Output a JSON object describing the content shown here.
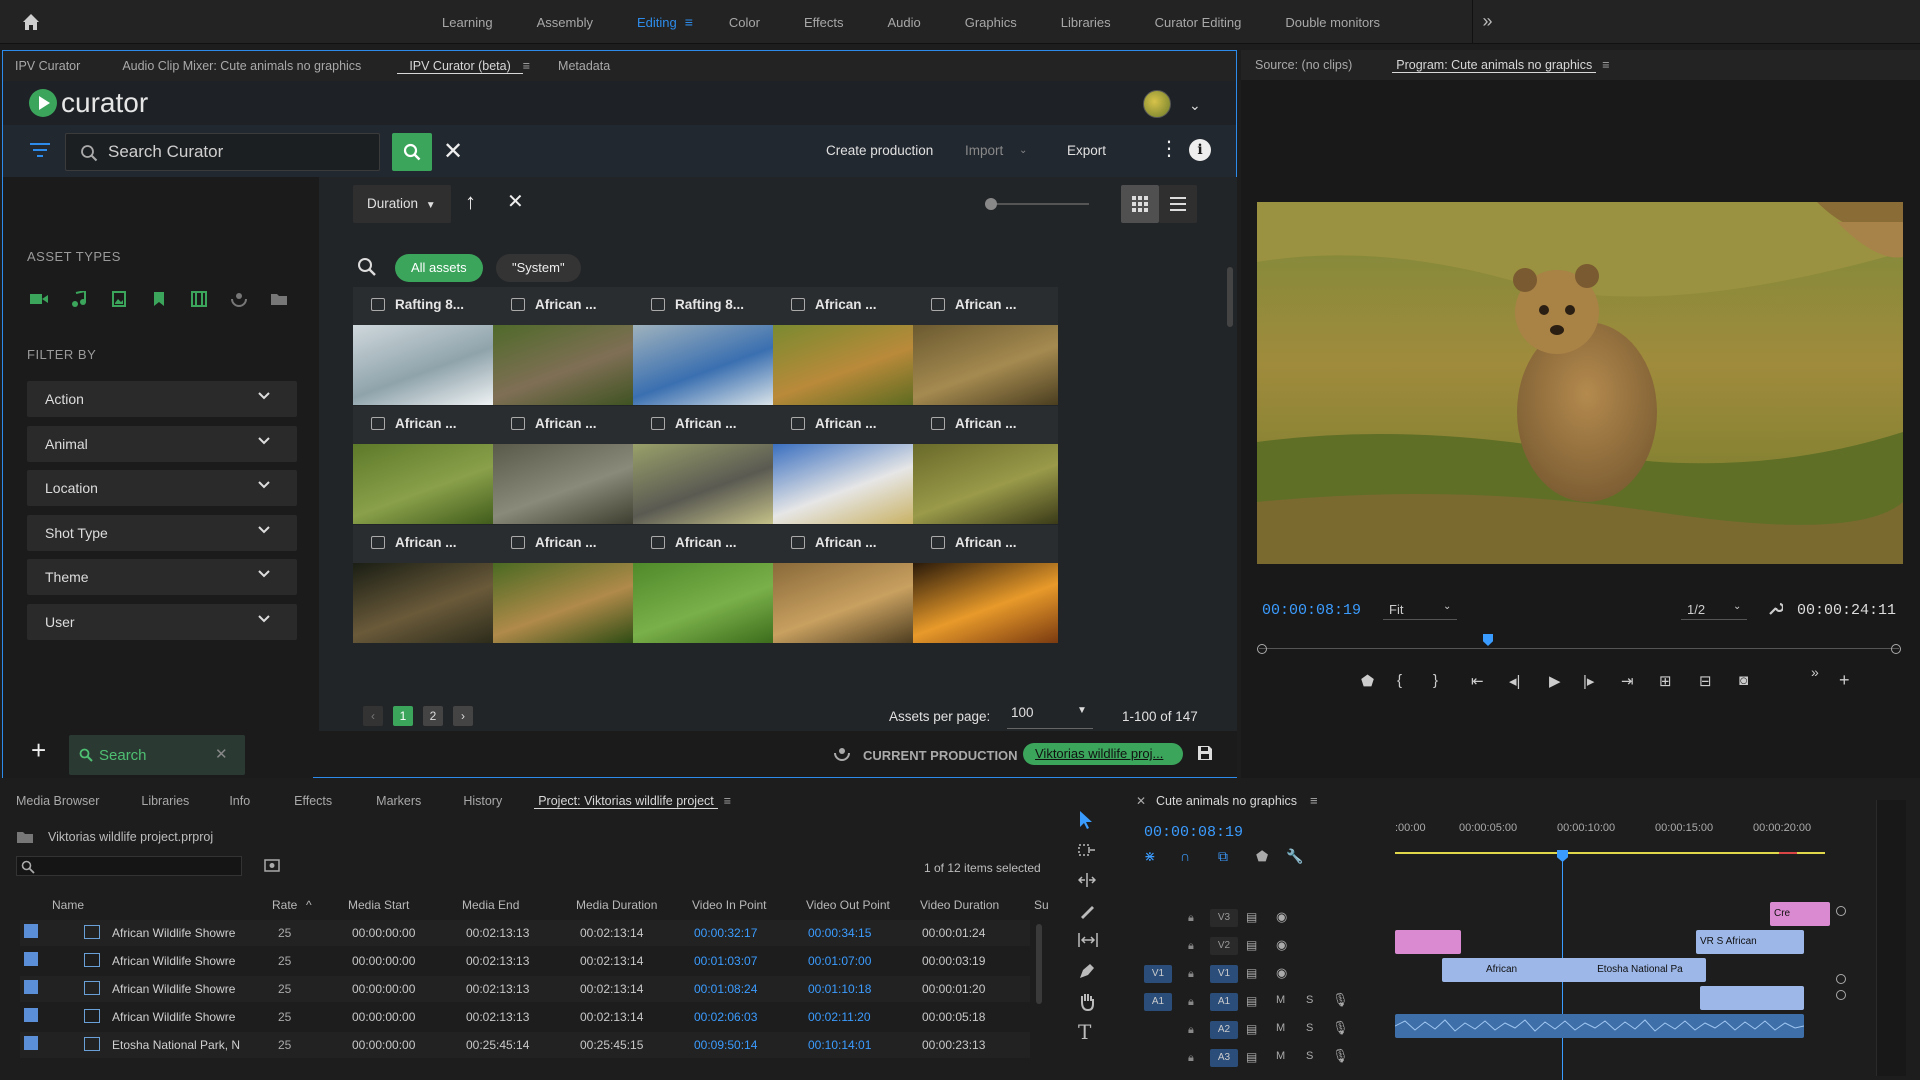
{
  "workspace": {
    "tabs": [
      "Learning",
      "Assembly",
      "Editing",
      "Color",
      "Effects",
      "Audio",
      "Graphics",
      "Libraries",
      "Curator Editing",
      "Double monitors"
    ],
    "active": "Editing"
  },
  "curator_panel": {
    "tabs": [
      "IPV Curator",
      "Audio Clip Mixer: Cute animals no graphics",
      "IPV Curator (beta)",
      "Metadata"
    ],
    "logo": "curator",
    "search_placeholder": "Search Curator",
    "toolbar": {
      "create": "Create production",
      "import": "Import",
      "export": "Export"
    },
    "asset_types_label": "ASSET TYPES",
    "filter_by_label": "FILTER BY",
    "filters": [
      "Action",
      "Animal",
      "Location",
      "Shot Type",
      "Theme",
      "User"
    ],
    "bottom_search": "Search",
    "sort": "Duration",
    "pills": [
      "All assets",
      "\"System\""
    ],
    "assets": [
      {
        "title": "Rafting 8...",
        "thumb": "water"
      },
      {
        "title": "African ...",
        "thumb": "rhino"
      },
      {
        "title": "Rafting 8...",
        "thumb": "raft"
      },
      {
        "title": "African ...",
        "thumb": "lion"
      },
      {
        "title": "African ...",
        "thumb": "grass"
      },
      {
        "title": "African ...",
        "thumb": "savanna"
      },
      {
        "title": "African ...",
        "thumb": "elephants"
      },
      {
        "title": "African ...",
        "thumb": "elephant"
      },
      {
        "title": "African ...",
        "thumb": "zebra"
      },
      {
        "title": "African ...",
        "thumb": "pond"
      },
      {
        "title": "African ...",
        "thumb": "night"
      },
      {
        "title": "African ...",
        "thumb": "leopard"
      },
      {
        "title": "African ...",
        "thumb": "field"
      },
      {
        "title": "African ...",
        "thumb": "leopard2"
      },
      {
        "title": "African ...",
        "thumb": "sunset"
      }
    ],
    "pages": [
      "1",
      "2"
    ],
    "assets_per_page_label": "Assets per page:",
    "assets_per_page": "100",
    "range": "1-100 of 147",
    "current_production_label": "CURRENT PRODUCTION",
    "current_production": "Viktorias wildlife proj..."
  },
  "monitor": {
    "tabs": [
      "Source: (no clips)",
      "Program: Cute animals no graphics"
    ],
    "timecode": "00:00:08:19",
    "fit": "Fit",
    "resolution": "1/2",
    "duration": "00:00:24:11"
  },
  "project": {
    "tabs": [
      "Media Browser",
      "Libraries",
      "Info",
      "Effects",
      "Markers",
      "History",
      "Project: Viktorias wildlife project"
    ],
    "file": "Viktorias wildlife project.prproj",
    "selected": "1 of 12 items selected",
    "columns": [
      "Name",
      "Rate",
      "Media Start",
      "Media End",
      "Media Duration",
      "Video In Point",
      "Video Out Point",
      "Video Duration",
      "Su"
    ],
    "rows": [
      {
        "name": "African Wildlife Showre",
        "rate": "25",
        "start": "00:00:00:00",
        "end": "00:02:13:13",
        "dur": "00:02:13:14",
        "in": "00:00:32:17",
        "out": "00:00:34:15",
        "vdur": "00:00:01:24"
      },
      {
        "name": "African Wildlife Showre",
        "rate": "25",
        "start": "00:00:00:00",
        "end": "00:02:13:13",
        "dur": "00:02:13:14",
        "in": "00:01:03:07",
        "out": "00:01:07:00",
        "vdur": "00:00:03:19"
      },
      {
        "name": "African Wildlife Showre",
        "rate": "25",
        "start": "00:00:00:00",
        "end": "00:02:13:13",
        "dur": "00:02:13:14",
        "in": "00:01:08:24",
        "out": "00:01:10:18",
        "vdur": "00:00:01:20"
      },
      {
        "name": "African Wildlife Showre",
        "rate": "25",
        "start": "00:00:00:00",
        "end": "00:02:13:13",
        "dur": "00:02:13:14",
        "in": "00:02:06:03",
        "out": "00:02:11:20",
        "vdur": "00:00:05:18"
      },
      {
        "name": "Etosha National Park, N",
        "rate": "25",
        "start": "00:00:00:00",
        "end": "00:25:45:14",
        "dur": "00:25:45:15",
        "in": "00:09:50:14",
        "out": "00:10:14:01",
        "vdur": "00:00:23:13"
      }
    ]
  },
  "timeline": {
    "sequence": "Cute animals no graphics",
    "timecode": "00:00:08:19",
    "ruler": [
      ":00:00",
      "00:00:05:00",
      "00:00:10:00",
      "00:00:15:00",
      "00:00:20:00"
    ],
    "video_tracks": [
      "V3",
      "V2",
      "V1"
    ],
    "audio_tracks": [
      "A1",
      "A2",
      "A3"
    ],
    "clips": {
      "african": "African",
      "etosha": "Etosha National Pa",
      "vr": "VR S",
      "african2": "African",
      "cre": "Cre"
    }
  }
}
